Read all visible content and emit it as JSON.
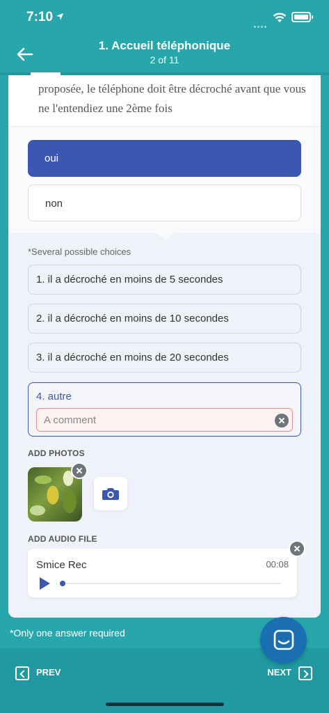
{
  "status_bar": {
    "time": "7:10"
  },
  "header": {
    "title": "1. Accueil téléphonique",
    "subtitle": "2 of 11"
  },
  "question": {
    "text": "proposée, le téléphone doit être décroché avant que vous ne l'entendiez une 2ème fois"
  },
  "answers": [
    {
      "label": "oui",
      "selected": true
    },
    {
      "label": "non",
      "selected": false
    }
  ],
  "details": {
    "note": "*Several possible choices",
    "choices": [
      "1. il a décroché en moins de 5 secondes",
      "2. il a décroché en moins de 10 secondes",
      "3. il a décroché en moins de 20 secondes",
      "4. autre"
    ],
    "comment_placeholder": "A comment",
    "add_photos_label": "ADD PHOTOS",
    "add_audio_label": "ADD AUDIO FILE",
    "audio": {
      "name": "Smice Rec",
      "duration": "00:08"
    }
  },
  "footnote": "*Only one answer required",
  "nav": {
    "prev_label": "PREV",
    "next_label": "NEXT"
  },
  "colors": {
    "teal_background": "#27a7ab",
    "accent_blue": "#3a57b2",
    "chat_blue": "#1a6fb2",
    "error_border": "#e88c8c"
  },
  "icons": {
    "back": "arrow-left-icon",
    "camera": "camera-icon",
    "play": "play-icon",
    "chat": "chat-icon",
    "remove": "close-icon"
  }
}
